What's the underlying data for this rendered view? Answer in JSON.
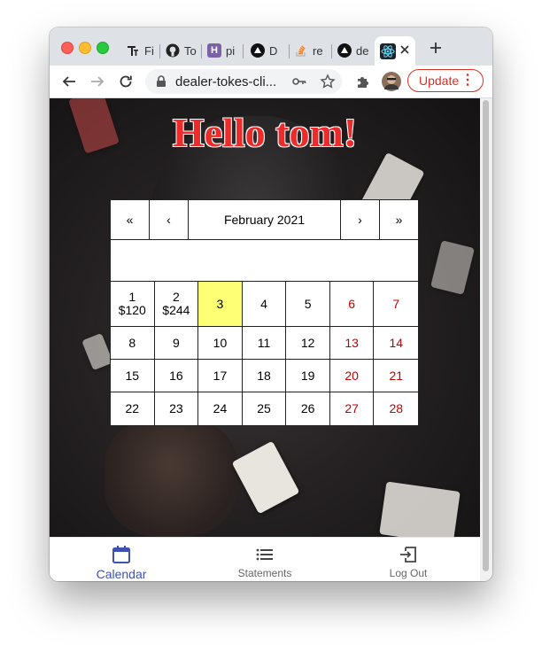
{
  "browser": {
    "tabs": [
      {
        "favicon": "typora-icon",
        "title": "Fi"
      },
      {
        "favicon": "github-icon",
        "title": "To"
      },
      {
        "favicon": "heroku-icon",
        "title": "pi"
      },
      {
        "favicon": "vercel-icon",
        "title": "D"
      },
      {
        "favicon": "stackoverflow-icon",
        "title": "re"
      },
      {
        "favicon": "vercel-icon",
        "title": "de"
      },
      {
        "favicon": "react-icon",
        "title": ""
      }
    ],
    "url": "dealer-tokes-cli...",
    "update_label": "Update"
  },
  "greeting": "Hello tom!",
  "calendar": {
    "nav": {
      "prev_year": "«",
      "prev_month": "‹",
      "month_label": "February 2021",
      "next_month": "›",
      "next_year": "»"
    },
    "highlight_day": "3",
    "weeks": [
      [
        {
          "day": "1",
          "amount": "$120"
        },
        {
          "day": "2",
          "amount": "$244"
        },
        {
          "day": "3",
          "amount": ""
        },
        {
          "day": "4",
          "amount": ""
        },
        {
          "day": "5",
          "amount": ""
        },
        {
          "day": "6",
          "amount": ""
        },
        {
          "day": "7",
          "amount": ""
        }
      ],
      [
        {
          "day": "8",
          "amount": ""
        },
        {
          "day": "9",
          "amount": ""
        },
        {
          "day": "10",
          "amount": ""
        },
        {
          "day": "11",
          "amount": ""
        },
        {
          "day": "12",
          "amount": ""
        },
        {
          "day": "13",
          "amount": ""
        },
        {
          "day": "14",
          "amount": ""
        }
      ],
      [
        {
          "day": "15",
          "amount": ""
        },
        {
          "day": "16",
          "amount": ""
        },
        {
          "day": "17",
          "amount": ""
        },
        {
          "day": "18",
          "amount": ""
        },
        {
          "day": "19",
          "amount": ""
        },
        {
          "day": "20",
          "amount": ""
        },
        {
          "day": "21",
          "amount": ""
        }
      ],
      [
        {
          "day": "22",
          "amount": ""
        },
        {
          "day": "23",
          "amount": ""
        },
        {
          "day": "24",
          "amount": ""
        },
        {
          "day": "25",
          "amount": ""
        },
        {
          "day": "26",
          "amount": ""
        },
        {
          "day": "27",
          "amount": ""
        },
        {
          "day": "28",
          "amount": ""
        }
      ]
    ]
  },
  "bottom_nav": [
    {
      "label": "Calendar",
      "icon": "calendar-icon",
      "active": true
    },
    {
      "label": "Statements",
      "icon": "list-icon",
      "active": false
    },
    {
      "label": "Log Out",
      "icon": "logout-icon",
      "active": false
    }
  ],
  "colors": {
    "accent": "#3f51b5",
    "weekend": "#c00000",
    "today": "#ffff76",
    "greeting": "#ee2b2b",
    "update": "#d93025"
  }
}
